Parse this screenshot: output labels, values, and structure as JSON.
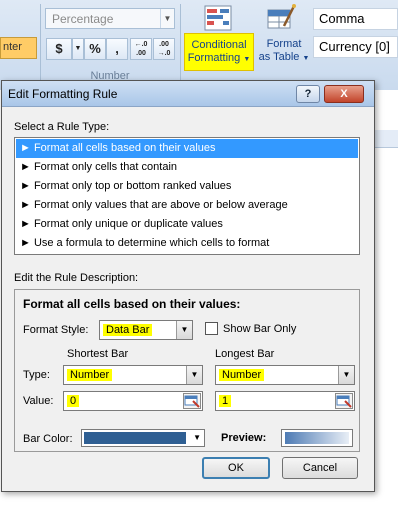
{
  "ribbon": {
    "center_btn_label": "nter",
    "number_format": "Percentage",
    "currency_symbol": "$",
    "percent_symbol": "%",
    "comma_symbol": ",",
    "inc_decimal": "←.0 .00",
    "dec_decimal": ".00 →.0",
    "number_group_label": "Number",
    "conditional_formatting_line1": "Conditional",
    "conditional_formatting_line2": "Formatting",
    "format_table_line1": "Format",
    "format_table_line2": "as Table",
    "style_comma": "Comma",
    "style_currency": "Currency [0]"
  },
  "dialog": {
    "title": "Edit Formatting Rule",
    "help_btn": "?",
    "close_btn": "X",
    "select_rule_type_label": "Select a Rule Type:",
    "rule_types": [
      "► Format all cells based on their values",
      "► Format only cells that contain",
      "► Format only top or bottom ranked values",
      "► Format only values that are above or below average",
      "► Format only unique or duplicate values",
      "► Use a formula to determine which cells to format"
    ],
    "edit_description_label": "Edit the Rule Description:",
    "description_title": "Format all cells based on their values:",
    "format_style_label": "Format Style:",
    "format_style_value": "Data Bar",
    "show_bar_only_label": "Show Bar Only",
    "shortest_bar_label": "Shortest Bar",
    "longest_bar_label": "Longest Bar",
    "type_label": "Type:",
    "value_label": "Value:",
    "shortest_type": "Number",
    "longest_type": "Number",
    "shortest_value": "0",
    "longest_value": "1",
    "bar_color_label": "Bar Color:",
    "preview_label": "Preview:",
    "ok_label": "OK",
    "cancel_label": "Cancel"
  },
  "colors": {
    "highlight": "#ffff00",
    "selection": "#3399ff",
    "bar_color": "#2f5f93"
  }
}
